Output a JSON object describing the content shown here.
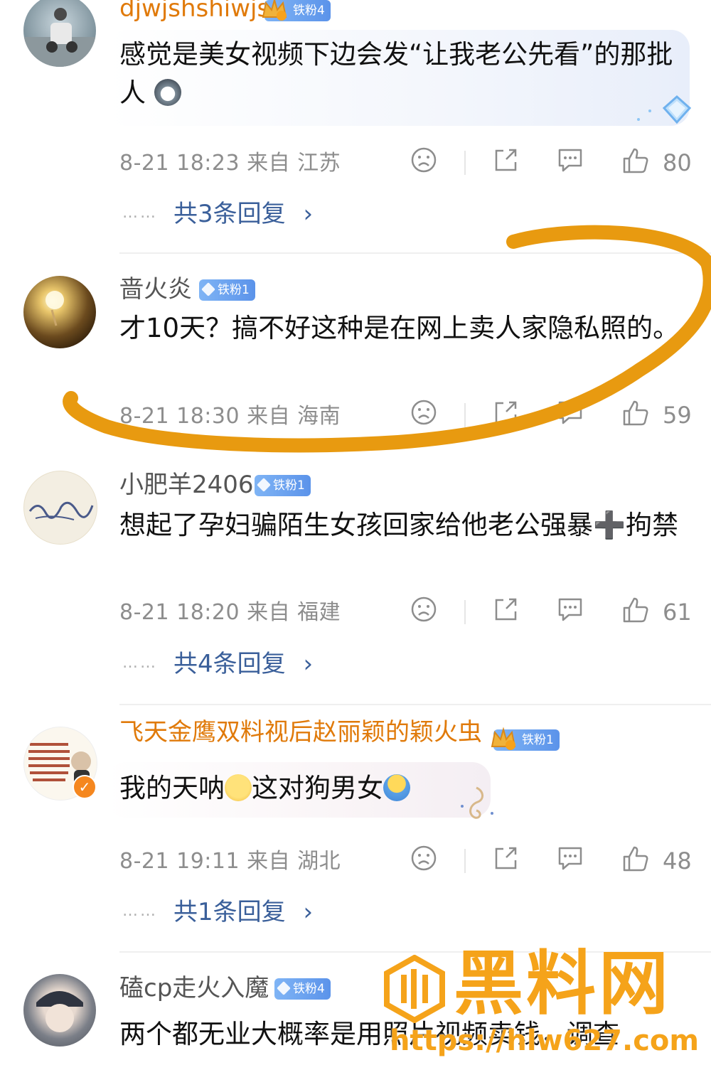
{
  "comments": [
    {
      "username": "djwjshshiwjs",
      "badge": "铁粉4",
      "text": "感觉是美女视频下边会发“让我老公先看”的那批人",
      "meta": "8-21 18:23  来自 江苏",
      "likes": "80",
      "replies": "共3条回复",
      "emoji_icon": "husky-dog-emoji"
    },
    {
      "username": "啬火炎",
      "badge": "铁粉1",
      "text": "才10天？搞不好这种是在网上卖人家隐私照的。",
      "meta": "8-21 18:30  来自 海南",
      "likes": "59"
    },
    {
      "username": "小肥羊2406",
      "badge": "铁粉1",
      "text": "想起了孕妇骗陌生女孩回家给他老公强暴➕拘禁",
      "meta": "8-21 18:20  来自 福建",
      "likes": "61",
      "replies": "共4条回复"
    },
    {
      "username": "飞天金鹰双料视后赵丽颖的颖火虫",
      "badge": "铁粉1",
      "text_a": "我的天呐",
      "text_b": "这对狗男女",
      "meta": "8-21 19:11  来自 湖北",
      "likes": "48",
      "replies": "共1条回复",
      "emoji_icons": [
        "scared-emoji",
        "shrug-emoji"
      ]
    },
    {
      "username": "磕cp走火入魔",
      "badge": "铁粉4",
      "text": "两个都无业大概率是用照片视频卖钱，调查"
    }
  ],
  "reply_chevron": "›",
  "reply_dots": "……",
  "colors": {
    "gold_username": "#e07a0a",
    "reply_link": "#3a5f9a",
    "badge_blue": "#5b93ea",
    "highlight_stroke": "#e89a10"
  },
  "watermark": {
    "logo_text": "黑料网",
    "url": "https://hlw627.com"
  }
}
